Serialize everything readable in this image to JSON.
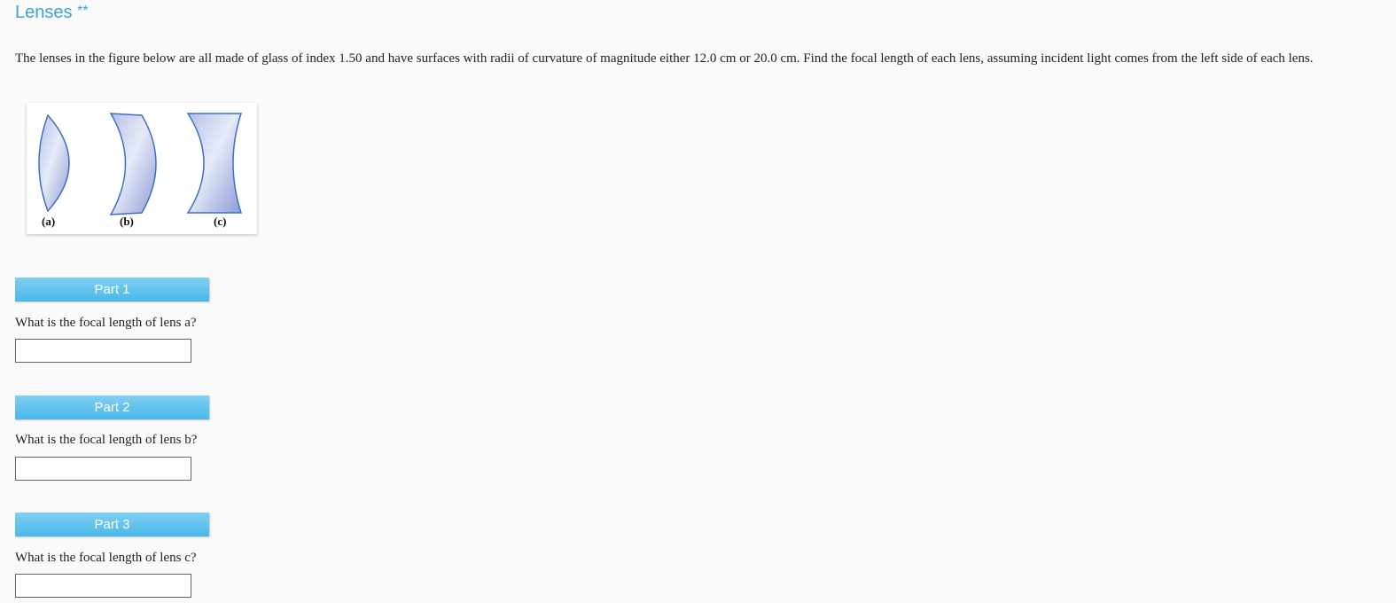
{
  "title": {
    "text": "Lenses",
    "stars": "**"
  },
  "problem": {
    "text": "The lenses in the figure below are all made of glass of index 1.50 and have surfaces with radii of curvature of magnitude either 12.0 cm or 20.0 cm. Find the focal length of each lens, assuming incident light comes from the left side of each lens."
  },
  "figure": {
    "labels": [
      "(a)",
      "(b)",
      "(c)"
    ],
    "colors": {
      "lens_fill_light": "#dce4f5",
      "lens_fill_dark": "#9aa8dc",
      "lens_stroke": "#3f6fc4"
    }
  },
  "parts": [
    {
      "header": "Part 1",
      "question": "What is the focal length of lens a?",
      "answer_value": ""
    },
    {
      "header": "Part 2",
      "question": "What is the focal length of lens b?",
      "answer_value": ""
    },
    {
      "header": "Part 3",
      "question": "What is the focal length of lens c?",
      "answer_value": ""
    }
  ],
  "colors": {
    "title": "#3aa3d9",
    "part_bar": "#4ab7e8",
    "background": "#fafafa"
  }
}
